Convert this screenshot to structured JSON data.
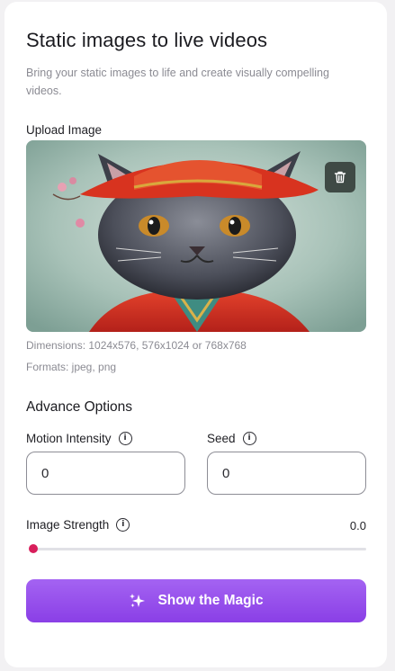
{
  "header": {
    "title": "Static images to live videos",
    "subtitle": "Bring your static images to life and create visually compelling videos."
  },
  "upload": {
    "label": "Upload Image",
    "image_description": "cat wearing red traditional hat and robe",
    "dimensions_text": "Dimensions: 1024x576, 576x1024 or 768x768",
    "formats_text": "Formats: jpeg, png"
  },
  "advanced": {
    "title": "Advance Options",
    "motion_intensity": {
      "label": "Motion Intensity",
      "value": "0"
    },
    "seed": {
      "label": "Seed",
      "value": "0"
    },
    "image_strength": {
      "label": "Image Strength",
      "value_text": "0.0",
      "value": 0.0
    }
  },
  "action": {
    "label": "Show the Magic"
  },
  "colors": {
    "accent": "#d81e5b",
    "button_top": "#a463f2",
    "button_bottom": "#8a3fe6"
  }
}
